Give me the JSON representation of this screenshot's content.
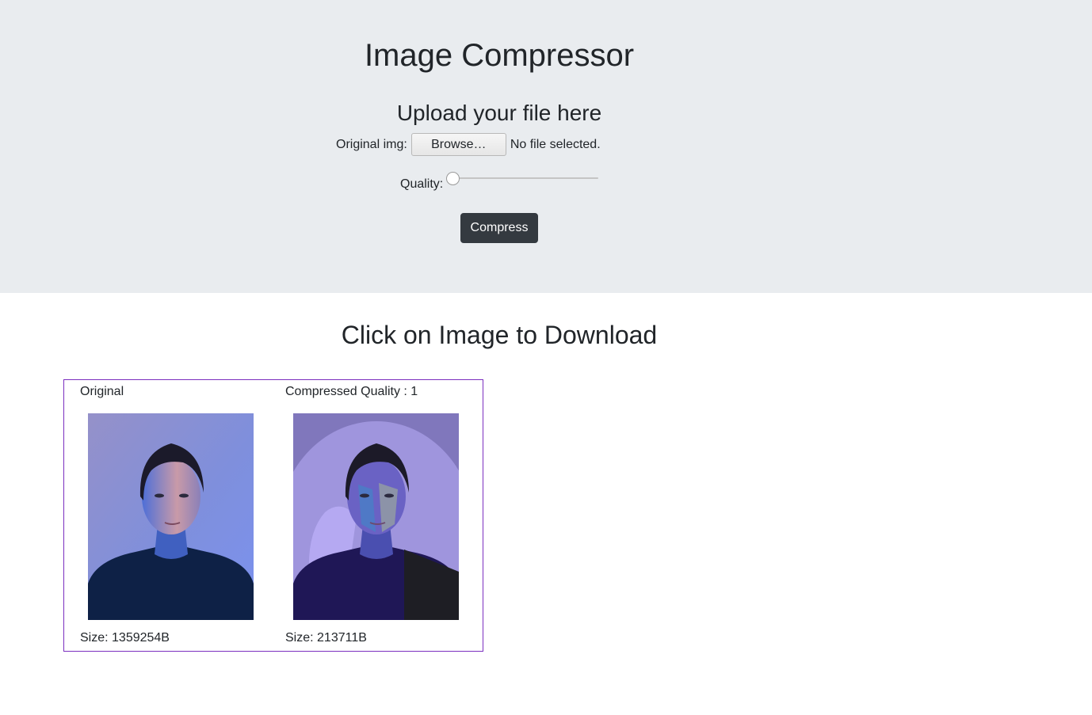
{
  "header": {
    "title": "Image Compressor",
    "subtitle": "Upload your file here"
  },
  "upload": {
    "label": "Original img:",
    "browse_label": "Browse…",
    "status": "No file selected."
  },
  "quality": {
    "label": "Quality:",
    "value": 1,
    "min": 1,
    "max": 100
  },
  "compress_label": "Compress",
  "download_title": "Click on Image to Download",
  "results": {
    "original": {
      "label": "Original",
      "size": "Size: 1359254B"
    },
    "compressed": {
      "label": "Compressed Quality : 1",
      "size": "Size: 213711B"
    }
  },
  "colors": {
    "hero_bg": "#e9ecef",
    "button_dark": "#343a40",
    "result_border": "#7b2fbf"
  }
}
